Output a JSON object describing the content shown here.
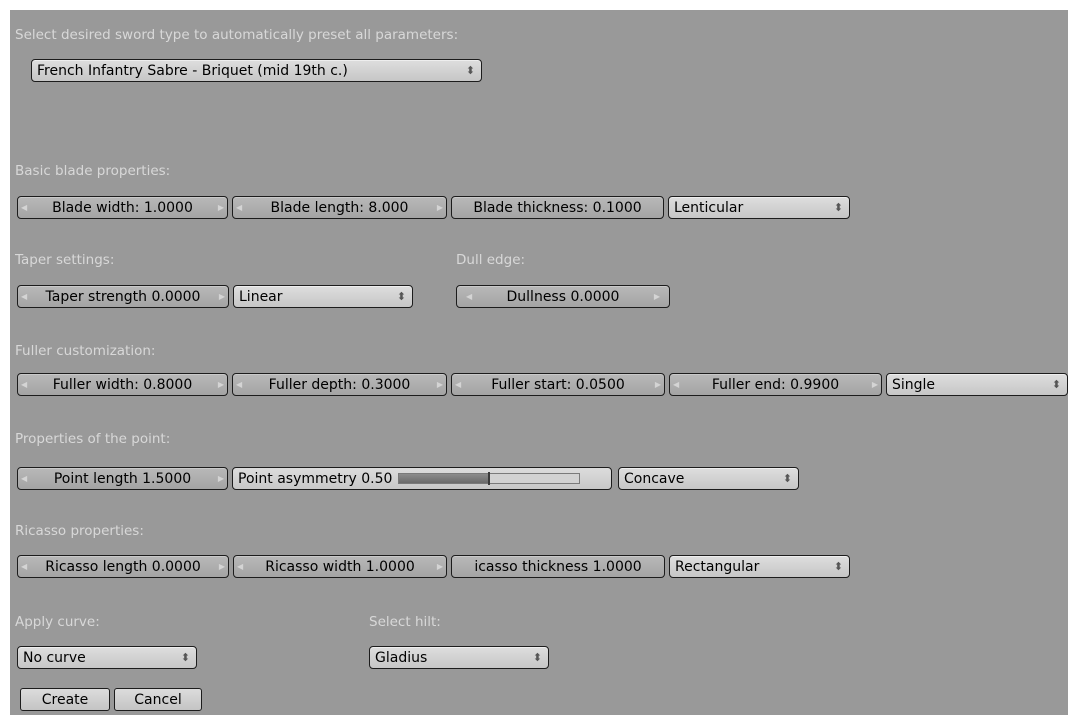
{
  "preset": {
    "label": "Select desired sword type to automatically preset all parameters:",
    "value": "French Infantry Sabre - Briquet (mid 19th c.)"
  },
  "blade": {
    "label": "Basic blade properties:",
    "width": "Blade width: 1.0000",
    "length": "Blade length: 8.000",
    "thickness": "Blade thickness: 0.1000",
    "profile": "Lenticular"
  },
  "taper": {
    "label": "Taper settings:",
    "strength": "Taper strength 0.0000",
    "mode": "Linear"
  },
  "dull": {
    "label": "Dull edge:",
    "dullness": "Dullness 0.0000"
  },
  "fuller": {
    "label": "Fuller customization:",
    "width": "Fuller width: 0.8000",
    "depth": "Fuller depth: 0.3000",
    "start": "Fuller start: 0.0500",
    "end": "Fuller end: 0.9900",
    "mode": "Single"
  },
  "point": {
    "label": "Properties of the point:",
    "length": "Point length 1.5000",
    "asymmetry_label": "Point asymmetry 0.50",
    "asymmetry_value": 0.5,
    "shape": "Concave"
  },
  "ricasso": {
    "label": "Ricasso properties:",
    "length": "Ricasso length 0.0000",
    "width": "Ricasso width 1.0000",
    "thickness": "icasso thickness 1.0000",
    "shape": "Rectangular"
  },
  "curve": {
    "label": "Apply curve:",
    "value": "No curve"
  },
  "hilt": {
    "label": "Select hilt:",
    "value": "Gladius"
  },
  "buttons": {
    "create": "Create",
    "cancel": "Cancel"
  },
  "icons": {
    "decrement": "left-arrow-icon",
    "increment": "right-arrow-icon",
    "dropdown": "up-down-arrows-icon"
  }
}
